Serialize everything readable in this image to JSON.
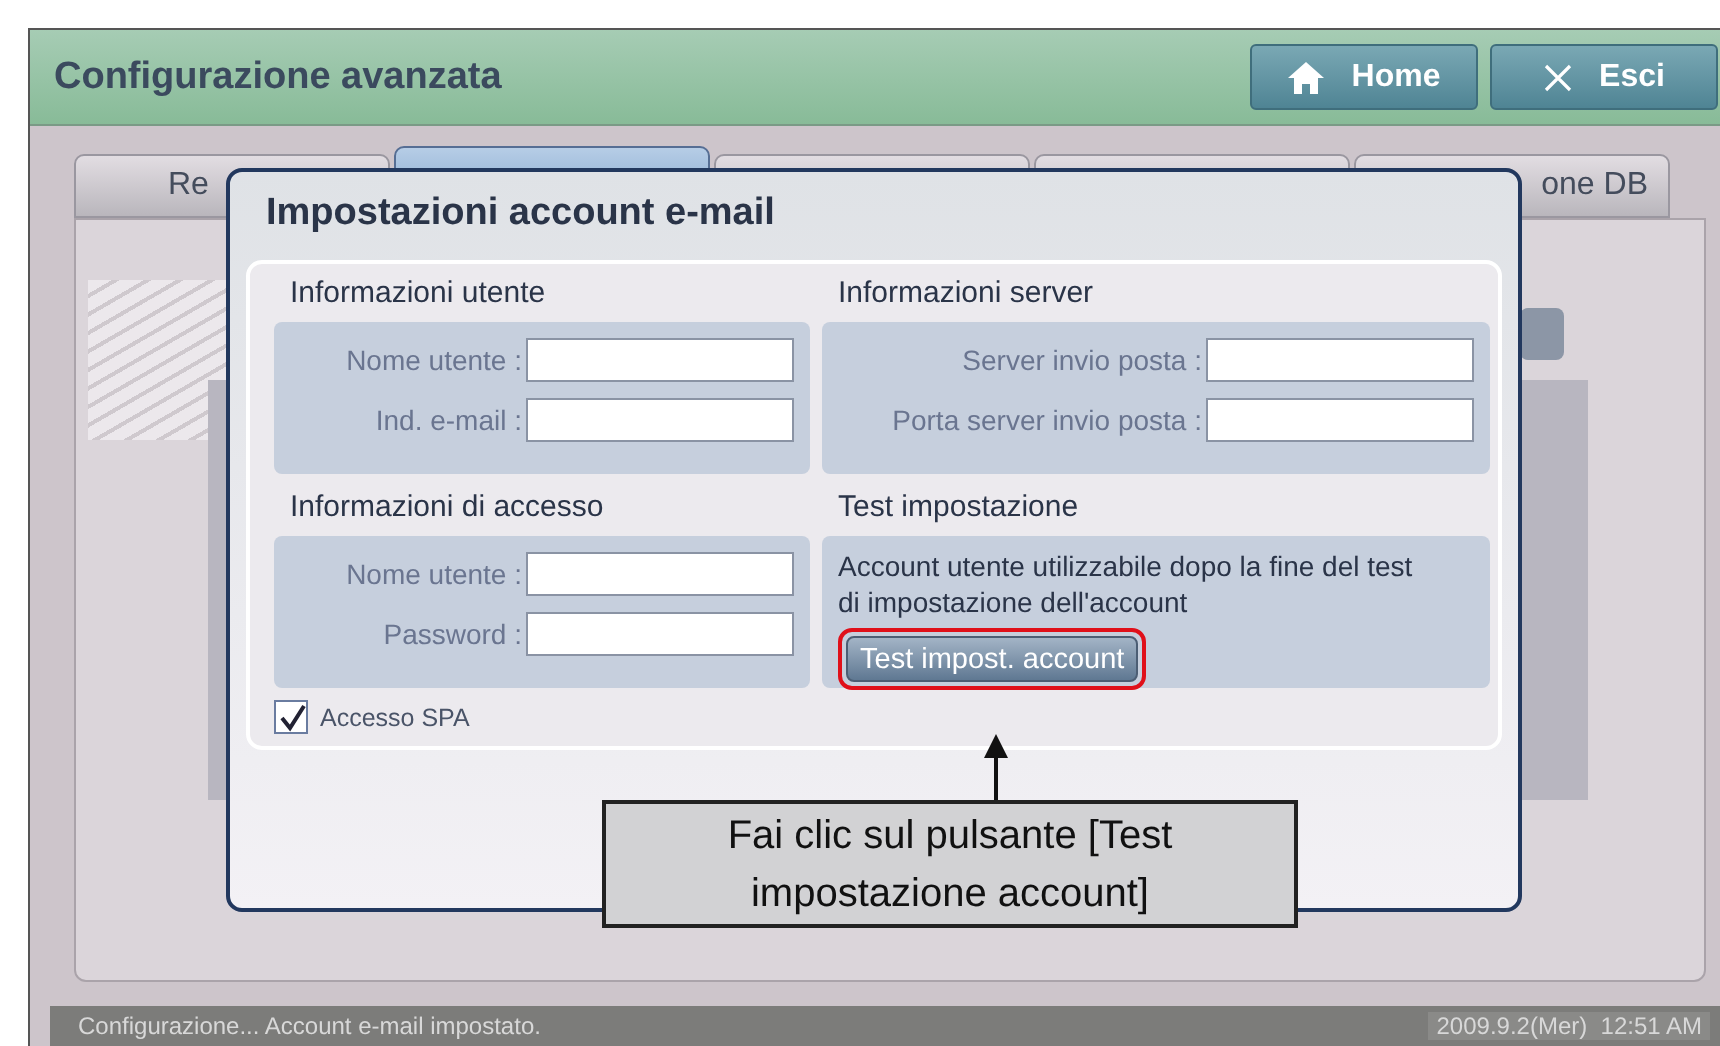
{
  "window": {
    "title": "Configurazione avanzata"
  },
  "header_buttons": [
    {
      "kind": "home",
      "label": "Home"
    },
    {
      "kind": "close",
      "label": "Esci"
    }
  ],
  "tabs": [
    {
      "label": "Re",
      "selected": false
    },
    {
      "selected": true
    },
    {
      "selected": false
    },
    {
      "selected": false
    },
    {
      "label": "one DB",
      "selected": false
    }
  ],
  "dialog": {
    "title": "Impostazioni account e-mail",
    "sections": [
      {
        "title": "Informazioni utente",
        "fields": [
          {
            "label": "Nome utente :"
          },
          {
            "label": "Ind. e-mail :"
          }
        ]
      },
      {
        "title": "Informazioni server",
        "fields": [
          {
            "label": "Server invio posta :"
          },
          {
            "label": "Porta server invio posta :"
          }
        ]
      },
      {
        "title": "Informazioni di accesso",
        "fields": [
          {
            "label": "Nome utente :"
          },
          {
            "label": "Password :"
          }
        ]
      },
      {
        "title": "Test impostazione",
        "note": "Account utente utilizzabile dopo la fine del test di impostazione dell'account",
        "button": "Test impost. account",
        "highlighted": true
      }
    ],
    "checkbox": {
      "label": "Accesso SPA",
      "checked": true
    }
  },
  "callout": {
    "text": "Fai clic sul pulsante [Test impostazione account]"
  },
  "status_bar": {
    "message": "Configurazione... Account e-mail impostato.",
    "datetime": "2009.9.2(Mer)  12:51 AM"
  }
}
